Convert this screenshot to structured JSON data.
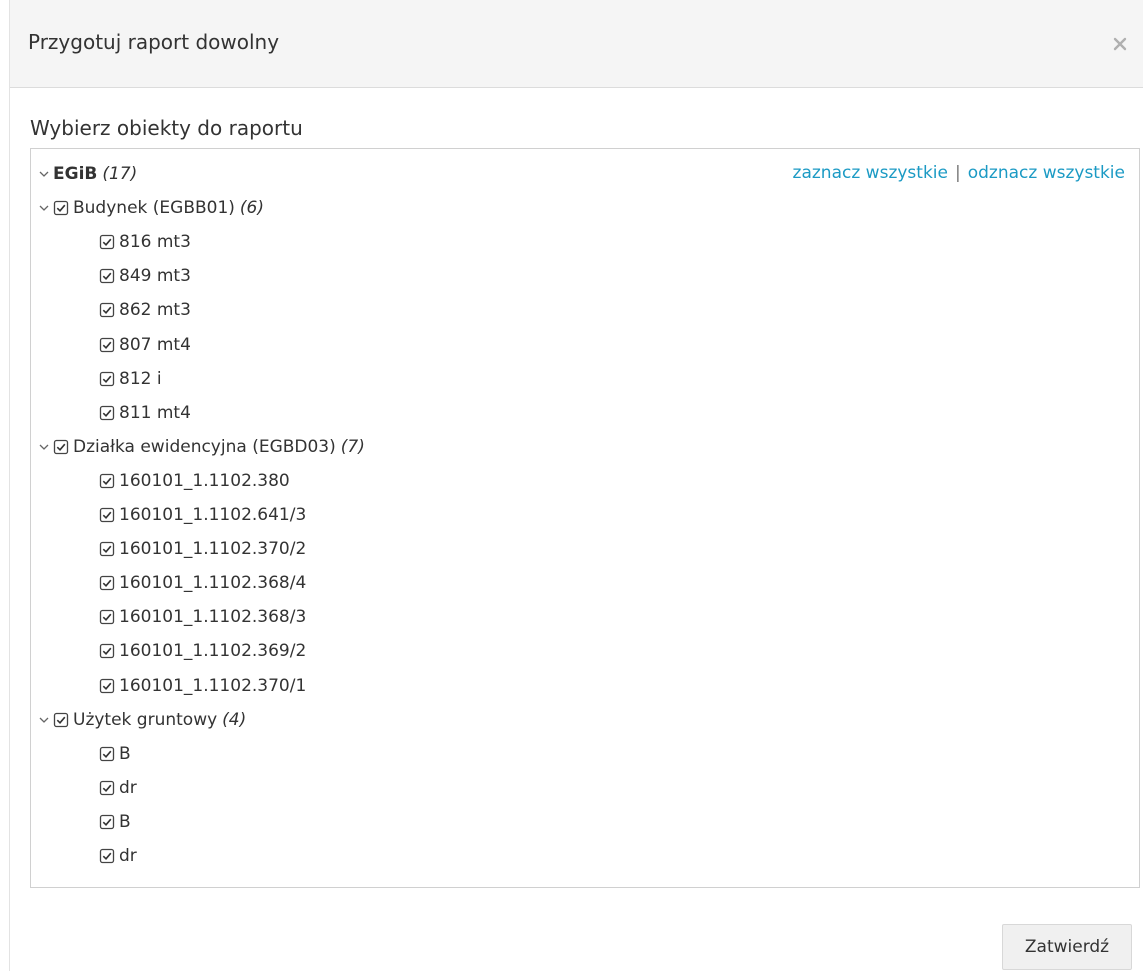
{
  "dialog": {
    "title": "Przygotuj raport dowolny",
    "close_symbol": "×"
  },
  "section_label": "Wybierz obiekty do raportu",
  "links": {
    "select_all": "zaznacz wszystkie",
    "separator": "|",
    "deselect_all": "odznacz wszystkie"
  },
  "tree": {
    "root": {
      "label": "EGiB",
      "count": "(17)"
    },
    "groups": [
      {
        "label": "Budynek (EGBB01)",
        "count": "(6)",
        "items": [
          "816 mt3",
          "849 mt3",
          "862 mt3",
          "807 mt4",
          "812 i",
          "811 mt4"
        ]
      },
      {
        "label": "Działka ewidencyjna (EGBD03)",
        "count": "(7)",
        "items": [
          "160101_1.1102.380",
          "160101_1.1102.641/3",
          "160101_1.1102.370/2",
          "160101_1.1102.368/4",
          "160101_1.1102.368/3",
          "160101_1.1102.369/2",
          "160101_1.1102.370/1"
        ]
      },
      {
        "label": "Użytek gruntowy",
        "count": "(4)",
        "items": [
          "B",
          "dr",
          "B",
          "dr"
        ]
      }
    ]
  },
  "footer": {
    "confirm_label": "Zatwierdź"
  },
  "icons": {
    "close": "close-icon",
    "expand": "chevron-down-icon",
    "checkbox": "checkbox-checked-icon"
  },
  "colors": {
    "link": "#1b9ac4",
    "header_bg": "#f5f5f5",
    "border": "#d0d0d0",
    "text": "#333333"
  }
}
